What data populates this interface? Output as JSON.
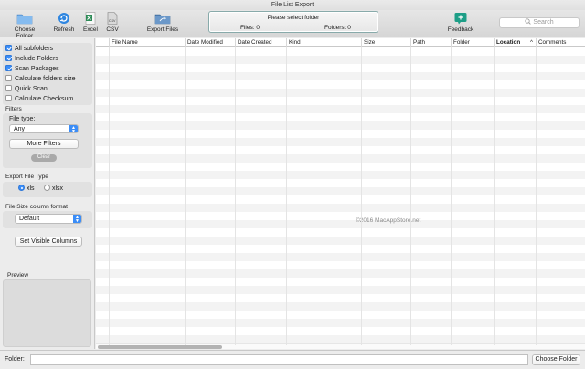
{
  "window": {
    "title": "File List Export"
  },
  "toolbar": {
    "choose_folder": "Choose Folder",
    "refresh": "Refresh",
    "excel": "Excel",
    "csv": "CSV",
    "export_files": "Export Files",
    "feedback": "Feedback",
    "csv_icon_text": "CSV"
  },
  "status": {
    "message": "Please select folder",
    "files": "Files: 0",
    "folders": "Folders: 0"
  },
  "search": {
    "placeholder": "Search",
    "icon": "magnifier-icon"
  },
  "options": {
    "all_subfolders": {
      "label": "All subfolders",
      "checked": true
    },
    "include_folders": {
      "label": "Include Folders",
      "checked": true
    },
    "scan_packages": {
      "label": "Scan Packages",
      "checked": true
    },
    "calc_folder_size": {
      "label": "Calculate folders size",
      "checked": false
    },
    "quick_scan": {
      "label": "Quick Scan",
      "checked": false
    },
    "calc_checksum": {
      "label": "Calculate Checksum",
      "checked": false
    }
  },
  "filters": {
    "heading": "Filters",
    "file_type_label": "File type:",
    "file_type_value": "Any",
    "more_filters": "More Filters",
    "clear": "Clear"
  },
  "export_type": {
    "heading": "Export File Type",
    "xls": {
      "label": "xls",
      "selected": true
    },
    "xlsx": {
      "label": "xlsx",
      "selected": false
    }
  },
  "size_format": {
    "heading": "File Size column format",
    "value": "Default"
  },
  "set_visible_columns": "Set Visible Columns",
  "preview": {
    "heading": "Preview"
  },
  "table": {
    "columns": [
      "File Name",
      "Date Modified",
      "Date Created",
      "Kind",
      "Size",
      "Path",
      "Folder",
      "Location",
      "Comments"
    ],
    "sort_indicator": "^",
    "rows": []
  },
  "watermark": "©2016 MacAppStore.net",
  "footer": {
    "folder_label": "Folder:",
    "folder_value": "",
    "choose_folder": "Choose Folder"
  },
  "colors": {
    "accent": "#3b8df7",
    "excel_green": "#2e8b57",
    "folder_blue": "#6aa7e4",
    "feedback_teal": "#1d9e87"
  }
}
